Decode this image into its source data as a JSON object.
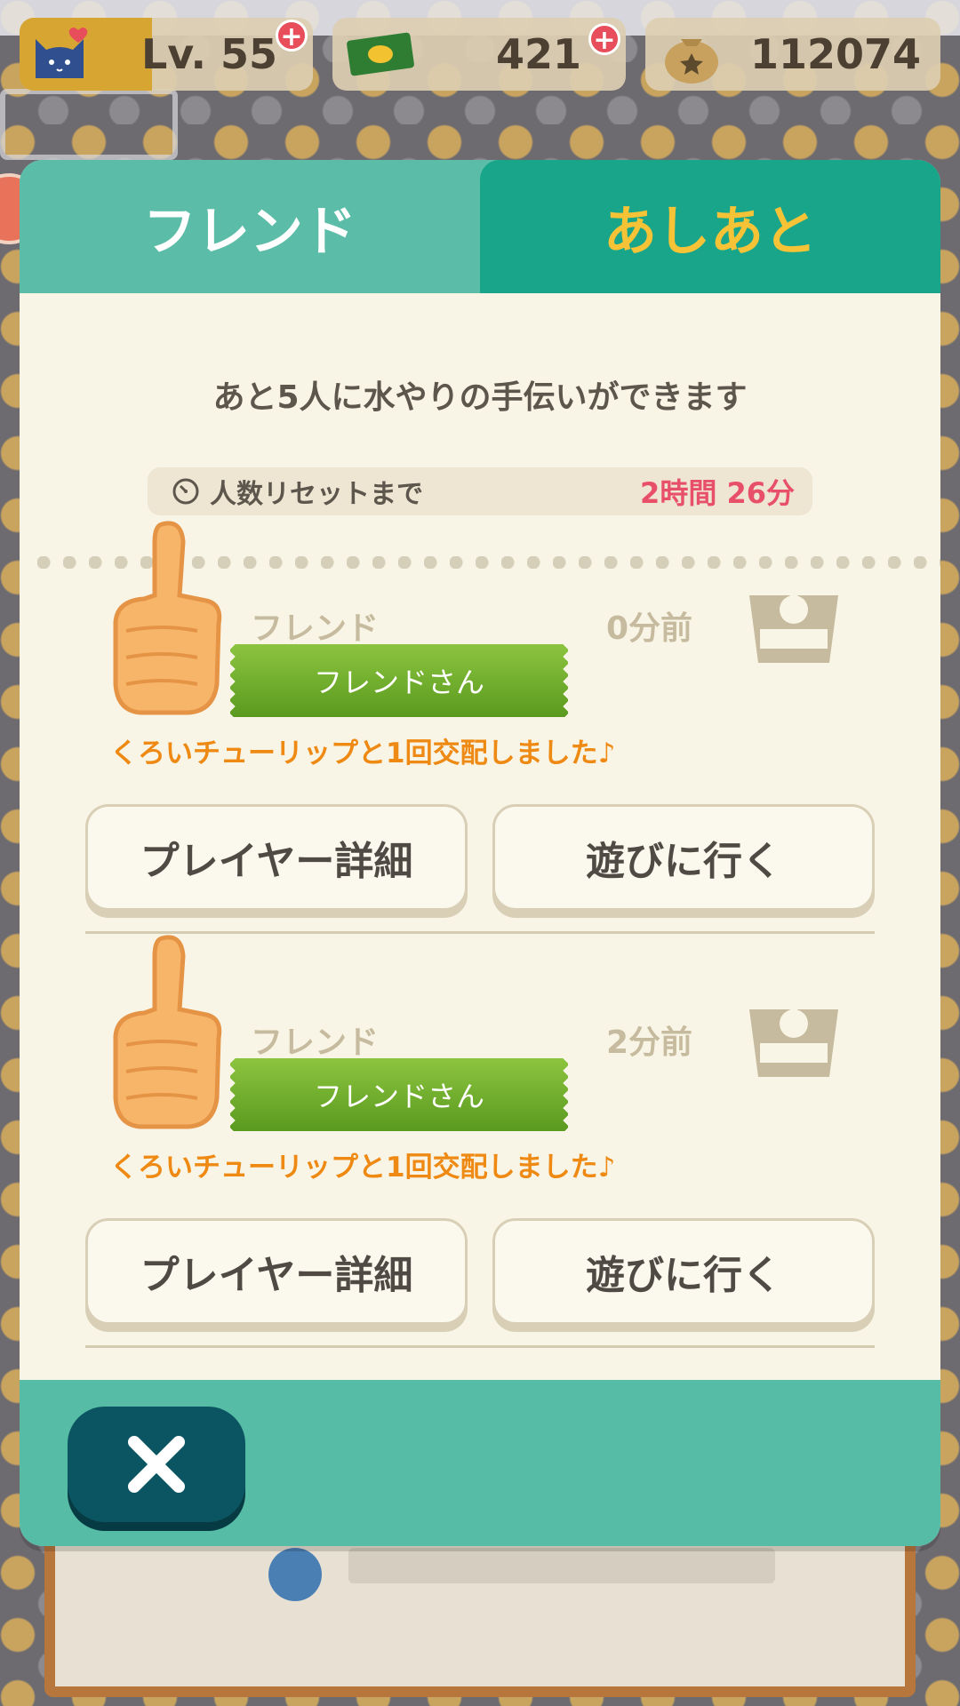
{
  "hud": {
    "level_label": "Lv. 55",
    "level_progress": 0.45,
    "tickets": "421",
    "bells": "112074"
  },
  "tabs": [
    {
      "label": "フレンド",
      "active": false
    },
    {
      "label": "あしあと",
      "active": true
    }
  ],
  "notice": "あと5人に水やりの手伝いができます",
  "reset": {
    "label": "人数リセットまで",
    "time": "2時間 26分"
  },
  "entries": [
    {
      "category": "フレンド",
      "time_ago": "0分前",
      "name": "フレンドさん",
      "message": "くろいチューリップと1回交配しました♪",
      "detail_button": "プレイヤー詳細",
      "visit_button": "遊びに行く"
    },
    {
      "category": "フレンド",
      "time_ago": "2分前",
      "name": "フレンドさん",
      "message": "くろいチューリップと1回交配しました♪",
      "detail_button": "プレイヤー詳細",
      "visit_button": "遊びに行く"
    }
  ],
  "colors": {
    "tab_active_bg": "#19a58a",
    "tab_inactive_bg": "#5bbda8",
    "active_tab_text": "#f6c337",
    "message_text": "#ee8a13",
    "reset_time_text": "#e8506a",
    "ribbon_green": "#7ab733",
    "close_button": "#0b5562"
  },
  "icons": {
    "level": "cat-heart-icon",
    "tickets": "leaf-ticket-icon",
    "bells": "bell-bag-icon",
    "reset": "clock-icon",
    "reaction": "thumbs-up-icon",
    "gift": "gift-box-icon",
    "close": "close-icon"
  }
}
